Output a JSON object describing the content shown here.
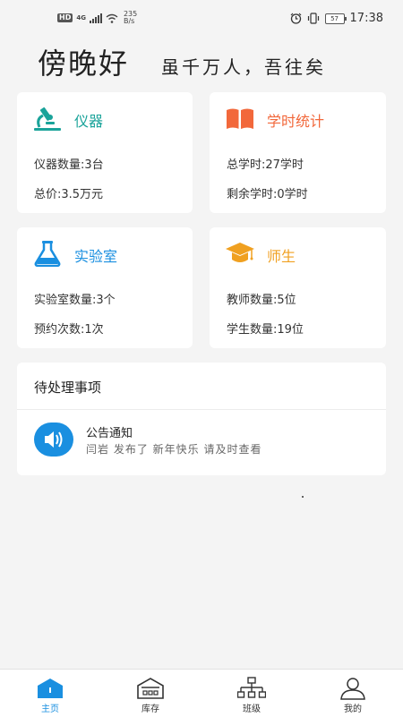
{
  "status_bar": {
    "hd": "HD",
    "network": "4G",
    "speed_value": "235",
    "speed_unit": "B/s",
    "battery": "57",
    "time": "17:38"
  },
  "header": {
    "greeting": "傍晚好",
    "motto": "虽千万人，吾往矣"
  },
  "cards": [
    {
      "title": "仪器",
      "line1": "仪器数量:3台",
      "line2": "总价:3.5万元",
      "color": "#1aa39a",
      "icon": "microscope-icon"
    },
    {
      "title": "学时统计",
      "line1": "总学时:27学时",
      "line2": "剩余学时:0学时",
      "color": "#f2683b",
      "icon": "book-icon"
    },
    {
      "title": "实验室",
      "line1": "实验室数量:3个",
      "line2": "预约次数:1次",
      "color": "#1a8fe0",
      "icon": "flask-icon"
    },
    {
      "title": "师生",
      "line1": "教师数量:5位",
      "line2": "学生数量:19位",
      "color": "#f0a020",
      "icon": "graduation-cap-icon"
    }
  ],
  "pending": {
    "title": "待处理事项",
    "notice_title": "公告通知",
    "notice_text": "闫岩 发布了 新年快乐 请及时查看",
    "icon": "speaker-icon"
  },
  "tabs": [
    {
      "label": "主页",
      "icon": "home-icon",
      "active": true
    },
    {
      "label": "库存",
      "icon": "warehouse-icon",
      "active": false
    },
    {
      "label": "班级",
      "icon": "org-chart-icon",
      "active": false
    },
    {
      "label": "我的",
      "icon": "user-icon",
      "active": false
    }
  ],
  "colors": {
    "accent": "#1a8fe0",
    "background": "#f4f4f4"
  }
}
